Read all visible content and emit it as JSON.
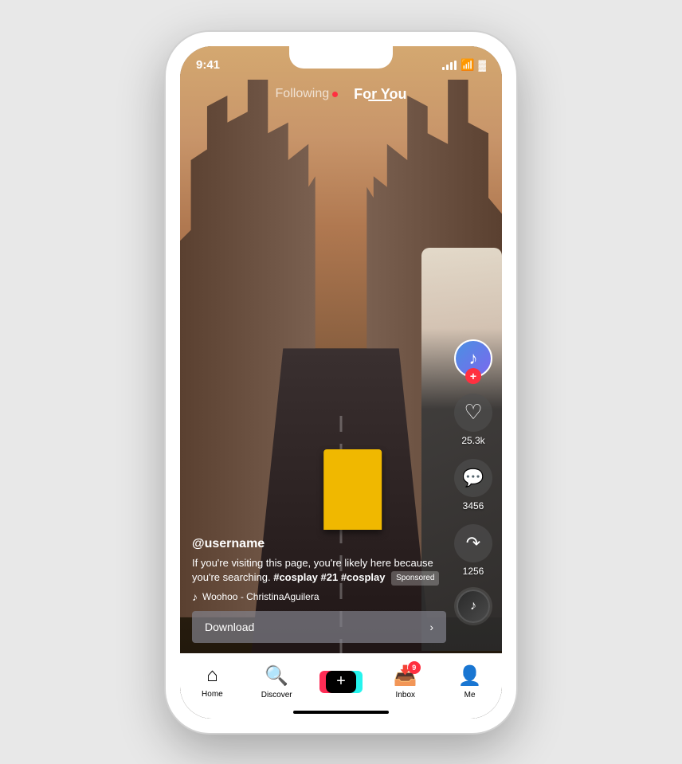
{
  "status_bar": {
    "time": "9:41",
    "signal": "●●●●",
    "wifi": "WiFi",
    "battery": "Battery"
  },
  "nav": {
    "following_label": "Following",
    "for_you_label": "For You"
  },
  "video": {
    "username": "@username",
    "description": "If you're visiting this page, you're likely here because you're searching.",
    "hashtags": "#cosplay #21 #cosplay",
    "sponsored_label": "Sponsored",
    "music_note": "♪",
    "music_title": "Woohoo - ChristinaAguilera",
    "download_label": "Download",
    "download_arrow": "›"
  },
  "actions": {
    "like_count": "25.3k",
    "comment_count": "3456",
    "share_count": "1256",
    "follow_icon": "+",
    "like_icon": "♡",
    "comment_icon": "···",
    "share_icon": "↷"
  },
  "bottom_nav": {
    "home_label": "Home",
    "discover_label": "Discover",
    "add_label": "+",
    "inbox_label": "Inbox",
    "inbox_badge": "9",
    "me_label": "Me"
  }
}
